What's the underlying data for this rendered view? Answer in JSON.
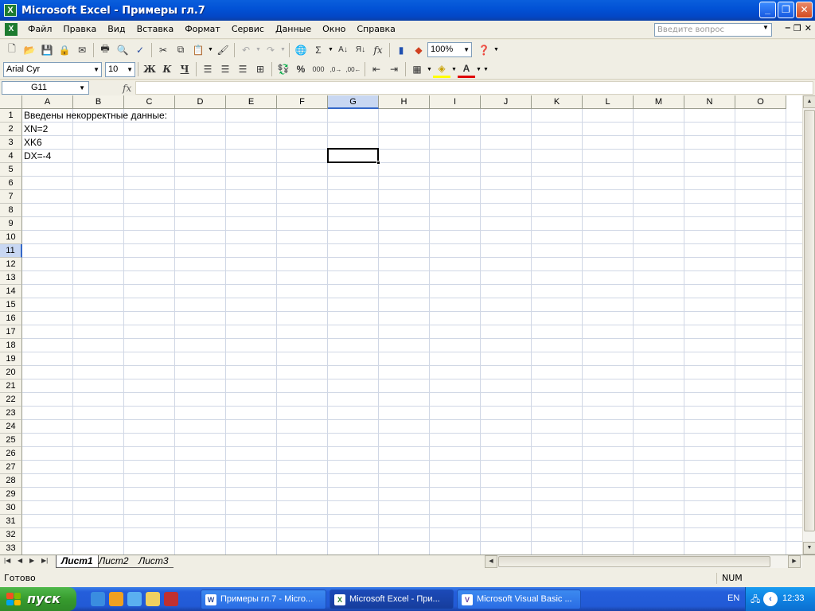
{
  "window": {
    "title": "Microsoft Excel - Примеры гл.7",
    "minimize": "_",
    "maximize": "❐",
    "close": "✕"
  },
  "menu": {
    "items": [
      "Файл",
      "Правка",
      "Вид",
      "Вставка",
      "Формат",
      "Сервис",
      "Данные",
      "Окно",
      "Справка"
    ],
    "question_placeholder": "Введите вопрос"
  },
  "toolbar": {
    "zoom": "100%",
    "font_name": "Arial Cyr",
    "font_size": "10",
    "bold": "Ж",
    "italic": "К",
    "underline": "Ч"
  },
  "formula_bar": {
    "name_box": "G11",
    "fx": "fx",
    "formula": ""
  },
  "grid": {
    "columns": [
      "A",
      "B",
      "C",
      "D",
      "E",
      "F",
      "G",
      "H",
      "I",
      "J",
      "K",
      "L",
      "M",
      "N",
      "O"
    ],
    "row_count": 33,
    "active_column": "G",
    "active_row": 11,
    "cells": [
      {
        "row": 1,
        "col": "A",
        "value": "Введены некорректные данные:"
      },
      {
        "row": 2,
        "col": "A",
        "value": "XN=2"
      },
      {
        "row": 3,
        "col": "A",
        "value": "XK6"
      },
      {
        "row": 4,
        "col": "A",
        "value": "DX=-4"
      }
    ]
  },
  "sheets": {
    "tabs": [
      "Лист1",
      "Лист2",
      "Лист3"
    ],
    "active": "Лист1"
  },
  "status": {
    "text": "Готово",
    "num": "NUM"
  },
  "taskbar": {
    "start_label": "пуск",
    "tasks": [
      {
        "label": "Примеры гл.7 - Micro...",
        "icon": "W",
        "active": false
      },
      {
        "label": "Microsoft Excel - При...",
        "icon": "X",
        "active": true
      },
      {
        "label": "Microsoft Visual Basic ...",
        "icon": "V",
        "active": false
      }
    ],
    "language": "EN",
    "clock": "12:33"
  }
}
